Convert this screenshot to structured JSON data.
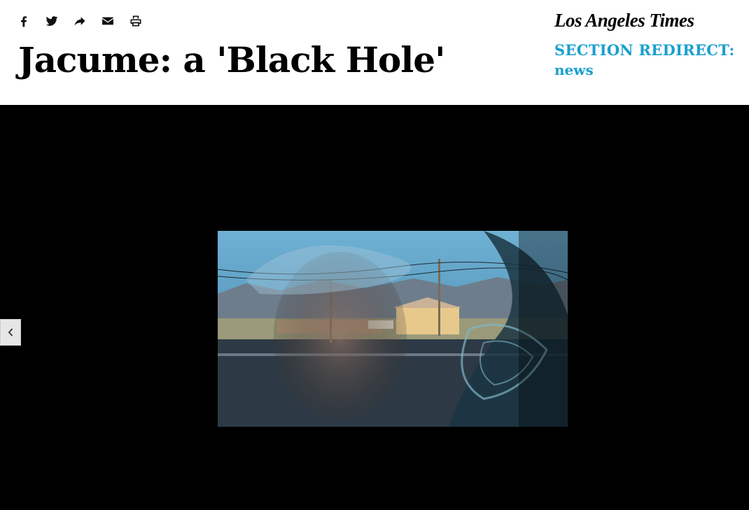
{
  "share": {
    "items": [
      {
        "icon": "facebook-icon",
        "label": "Facebook"
      },
      {
        "icon": "twitter-icon",
        "label": "Twitter"
      },
      {
        "icon": "share-icon",
        "label": "Share"
      },
      {
        "icon": "email-icon",
        "label": "Email"
      },
      {
        "icon": "print-icon",
        "label": "Print"
      }
    ]
  },
  "page": {
    "title": "Jacume: a 'Black Hole'"
  },
  "brand": {
    "logo_text": "Los Angeles Times",
    "section_label": "SECTION REDIRECT:",
    "section_name": "news"
  },
  "gallery": {
    "prev_icon": "chevron-left-icon",
    "photo_description_icon": "photo"
  },
  "colors": {
    "accent": "#1a9fcf",
    "gallery_bg": "#000000"
  }
}
